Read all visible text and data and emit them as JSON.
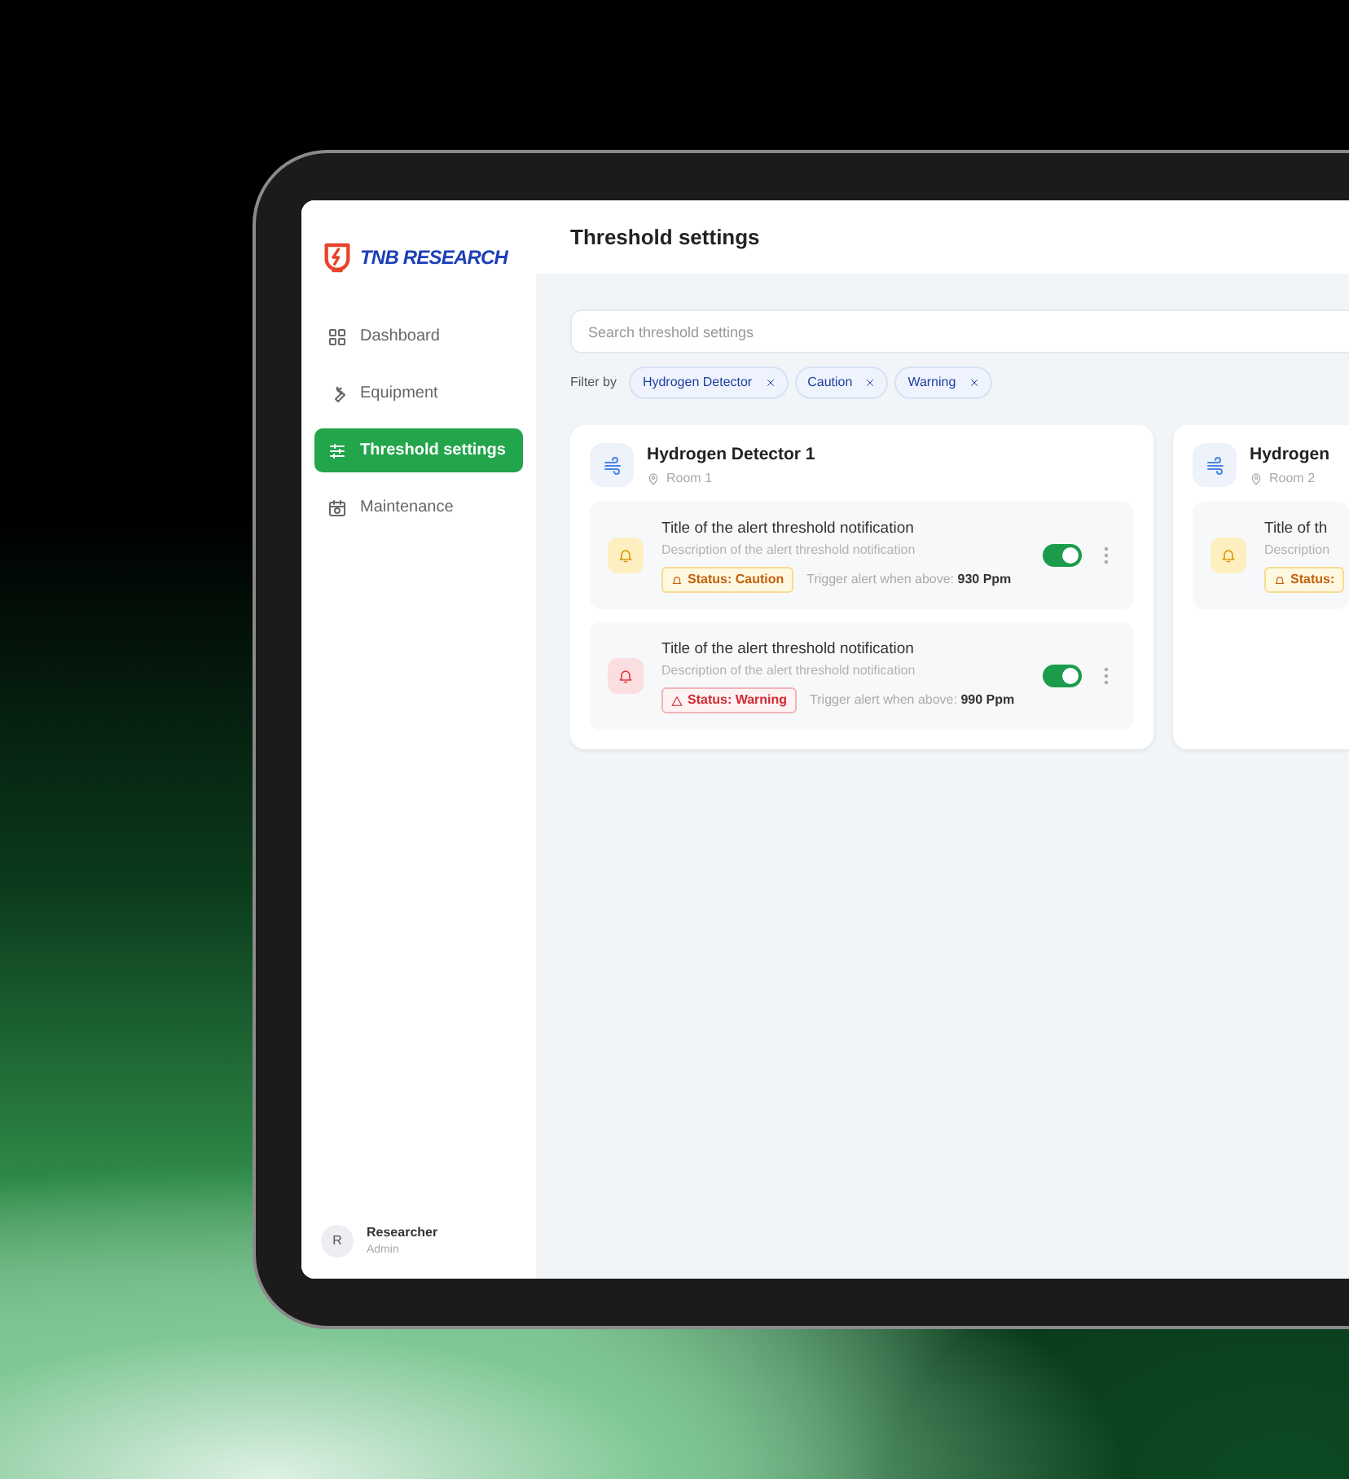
{
  "app": {
    "logo": "TNB RESEARCH",
    "nav": [
      {
        "label": "Dashboard",
        "selected": false
      },
      {
        "label": "Equipment",
        "selected": false
      },
      {
        "label": "Threshold settings",
        "selected": true
      },
      {
        "label": "Maintenance",
        "selected": false
      }
    ],
    "user": {
      "initial": "R",
      "name": "Researcher",
      "role": "Admin"
    }
  },
  "header": {
    "title": "Threshold settings"
  },
  "search": {
    "placeholder": "Search threshold settings"
  },
  "filters": {
    "label": "Filter by",
    "chips": [
      {
        "label": "Hydrogen Detector"
      },
      {
        "label": "Caution"
      },
      {
        "label": "Warning"
      }
    ]
  },
  "devices": [
    {
      "name": "Hydrogen Detector 1",
      "location": "Room 1",
      "alerts": [
        {
          "kind": "caution",
          "title": "Title of the alert threshold notification",
          "description": "Description of the alert threshold notification",
          "status": "Status: Caution",
          "trigger_label": "Trigger alert when above:",
          "trigger_value": "930 Ppm",
          "on": true
        },
        {
          "kind": "warning",
          "title": "Title of the alert threshold notification",
          "description": "Description of the alert threshold notification",
          "status": "Status: Warning",
          "trigger_label": "Trigger alert when above:",
          "trigger_value": "990 Ppm",
          "on": true
        }
      ]
    },
    {
      "name": "Hydrogen",
      "location": "Room 2",
      "alerts": [
        {
          "kind": "caution",
          "title": "Title of th",
          "description": "Description",
          "status": "Status:"
        }
      ]
    }
  ]
}
